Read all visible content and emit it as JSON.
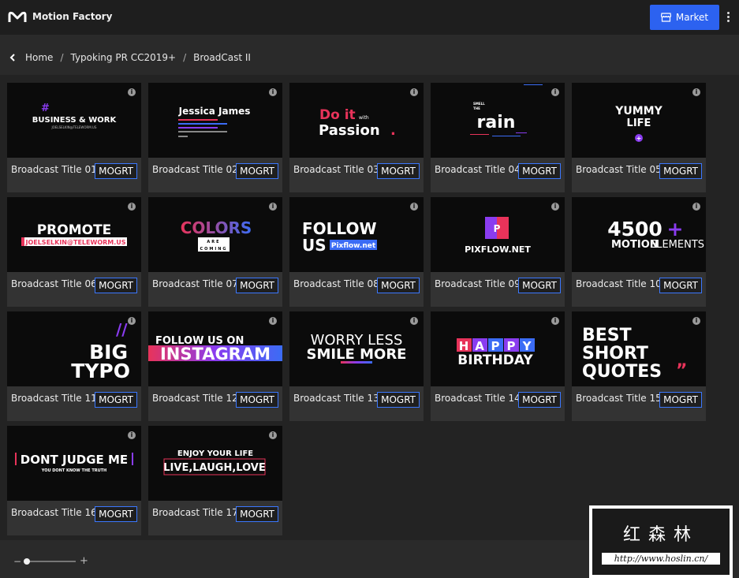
{
  "app": {
    "title": "Motion Factory"
  },
  "header": {
    "market_label": "Market"
  },
  "breadcrumb": {
    "items": [
      "Home",
      "Typoking PR CC2019+",
      "BroadCast II"
    ]
  },
  "card_button_label": "MOGRT",
  "info_glyph": "i",
  "cards": [
    {
      "title": "Broadcast Title 01",
      "preview": [
        "#",
        "BUSINESS & WORK",
        "JOELSELKIN@TELEWORM.US"
      ]
    },
    {
      "title": "Broadcast Title 02",
      "preview": [
        "Jessica James"
      ]
    },
    {
      "title": "Broadcast Title 03",
      "preview": [
        "Do it",
        "with",
        "Passion",
        "."
      ]
    },
    {
      "title": "Broadcast Title 04",
      "preview": [
        "SMELL",
        "THE",
        "rain"
      ]
    },
    {
      "title": "Broadcast Title 05",
      "preview": [
        "YUMMY",
        "LIFE",
        "+"
      ]
    },
    {
      "title": "Broadcast Title 06",
      "preview": [
        "PROMOTE",
        "JOELSELKIN@TELEWORM.US"
      ]
    },
    {
      "title": "Broadcast Title 07",
      "preview": [
        "COLORS",
        "ARE",
        "COMING"
      ]
    },
    {
      "title": "Broadcast Title 08",
      "preview": [
        "FOLLOW",
        "US",
        "Pixflow.net"
      ]
    },
    {
      "title": "Broadcast Title 09",
      "preview": [
        "P",
        "PIXFLOW.NET"
      ]
    },
    {
      "title": "Broadcast Title 10",
      "preview": [
        "4500",
        "+",
        "MOTION",
        "ELEMENTS"
      ]
    },
    {
      "title": "Broadcast Title 11",
      "preview": [
        "//",
        "BIG",
        "TYPO"
      ]
    },
    {
      "title": "Broadcast Title 12",
      "preview": [
        "FOLLOW US ON",
        "INSTAGRAM"
      ]
    },
    {
      "title": "Broadcast Title 13",
      "preview": [
        "WORRY LESS",
        "SMILE MORE"
      ]
    },
    {
      "title": "Broadcast Title 14",
      "preview": [
        "H",
        "A",
        "P",
        "P",
        "Y",
        "BIRTHDAY"
      ]
    },
    {
      "title": "Broadcast Title 15",
      "preview": [
        "BEST",
        "SHORT",
        "QUOTES",
        "”"
      ]
    },
    {
      "title": "Broadcast Title 16",
      "preview": [
        "DONT JUDGE ME",
        "YOU DONT KNOW THE TRUTH"
      ]
    },
    {
      "title": "Broadcast Title 17",
      "preview": [
        "ENJOY YOUR LIFE",
        "LIVE,LAUGH,LOVE"
      ]
    }
  ],
  "zoom": {
    "minus": "−",
    "plus": "+",
    "level": 0.0
  },
  "watermark": {
    "cn": "红森林",
    "url": "http://www.hoslin.cn/"
  },
  "colors": {
    "accent": "#2c62f0",
    "mogrt_border": "#3b78ff",
    "pink": "#e8335a",
    "purple": "#8a3cf0",
    "blue": "#3b6cf5"
  }
}
